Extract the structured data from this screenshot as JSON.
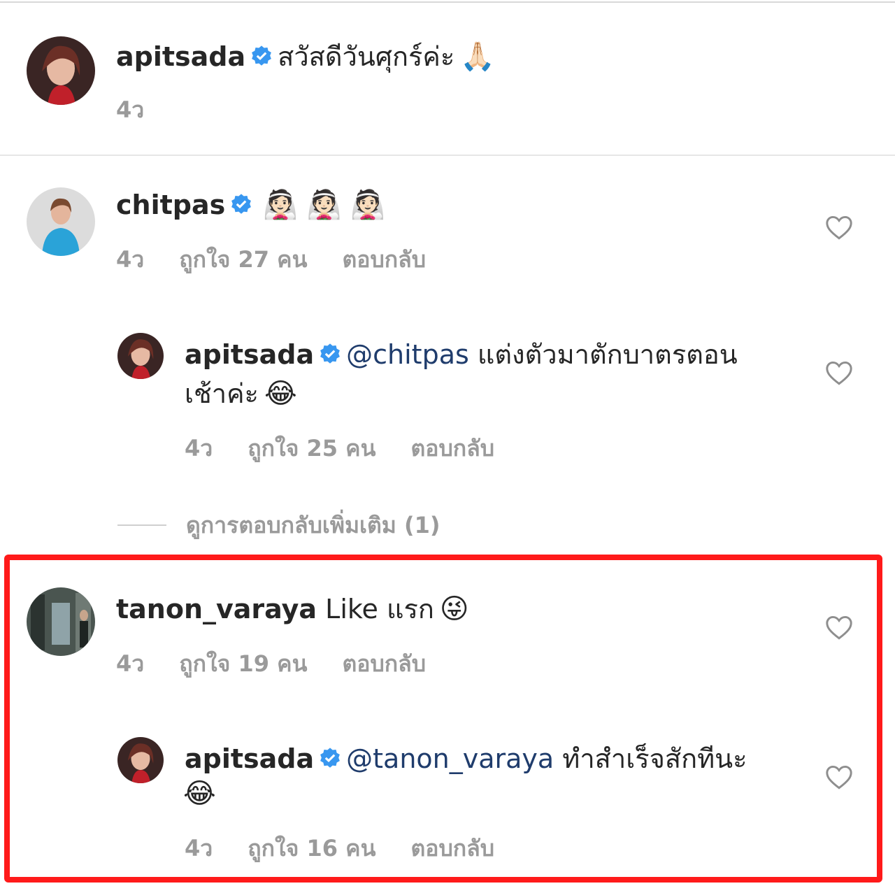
{
  "caption": {
    "username": "apitsada",
    "text": "สวัสดีวันศุกร์ค่ะ",
    "emoji": "🙏🏻",
    "time": "4ว"
  },
  "comments": [
    {
      "username": "chitpas",
      "text": "",
      "emoji": "👰🏻 👰🏻 👰🏻",
      "time": "4ว",
      "likes": "ถูกใจ 27 คน",
      "reply_label": "ตอบกลับ",
      "reply": {
        "username": "apitsada",
        "mention": "@chitpas",
        "text_line1": "แต่งตัวมาตักบาตรตอน",
        "text_line2": "เช้าค่ะ",
        "emoji": "😂",
        "time": "4ว",
        "likes": "ถูกใจ 25 คน",
        "reply_label": "ตอบกลับ"
      },
      "view_more": "ดูการตอบกลับเพิ่มเติม (1)"
    },
    {
      "username": "tanon_varaya",
      "text": "Like แรก",
      "emoji": "😜",
      "time": "4ว",
      "likes": "ถูกใจ 19 คน",
      "reply_label": "ตอบกลับ",
      "reply": {
        "username": "apitsada",
        "mention": "@tanon_varaya",
        "text_line1": "ทำสำเร็จสักทีนะ",
        "emoji": "😂",
        "time": "4ว",
        "likes": "ถูกใจ 16 คน",
        "reply_label": "ตอบกลับ"
      }
    }
  ],
  "colors": {
    "verified": "#3897f0",
    "mention": "#1f3c6c",
    "highlight_border": "#ff1a1a",
    "meta_text": "#9a9a9a"
  }
}
